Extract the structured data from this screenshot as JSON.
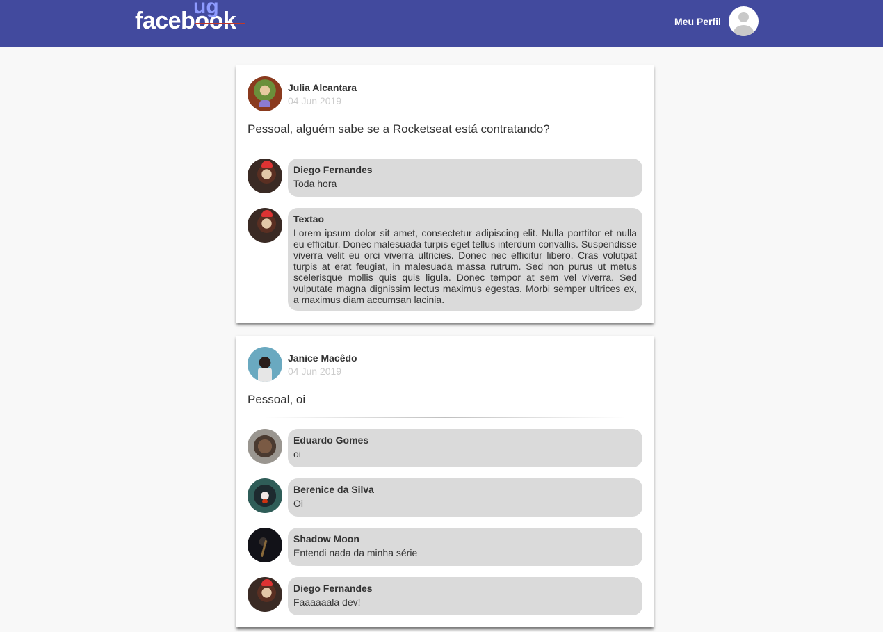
{
  "header": {
    "logo_main": "facebook",
    "logo_sup": "ug",
    "profile_label": "Meu Perfil",
    "profile_icon": "user-silhouette-icon",
    "background": "#424a9e"
  },
  "posts": [
    {
      "author": "Julia Alcantara",
      "date": "04 Jun 2019",
      "content": "Pessoal, alguém sabe se a Rocketseat está contratando?",
      "comments": [
        {
          "author": "Diego Fernandes",
          "content": "Toda hora"
        },
        {
          "author": "Textao",
          "content": "Lorem ipsum dolor sit amet, consectetur adipiscing elit. Nulla porttitor et nulla eu efficitur. Donec malesuada turpis eget tellus interdum convallis. Suspendisse viverra velit eu orci viverra ultricies. Donec nec efficitur libero. Cras volutpat turpis at erat feugiat, in malesuada massa rutrum. Sed non purus ut metus scelerisque mollis quis quis ligula. Donec tempor at sem vel viverra. Sed vulputate magna dignissim lectus maximus egestas. Morbi semper ultrices ex, a maximus diam accumsan lacinia."
        }
      ]
    },
    {
      "author": "Janice Macêdo",
      "date": "04 Jun 2019",
      "content": "Pessoal, oi",
      "comments": [
        {
          "author": "Eduardo Gomes",
          "content": "oi"
        },
        {
          "author": "Berenice da Silva",
          "content": "Oi"
        },
        {
          "author": "Shadow Moon",
          "content": "Entendi nada da minha série"
        },
        {
          "author": "Diego Fernandes",
          "content": "Faaaaaala dev!"
        }
      ]
    }
  ]
}
